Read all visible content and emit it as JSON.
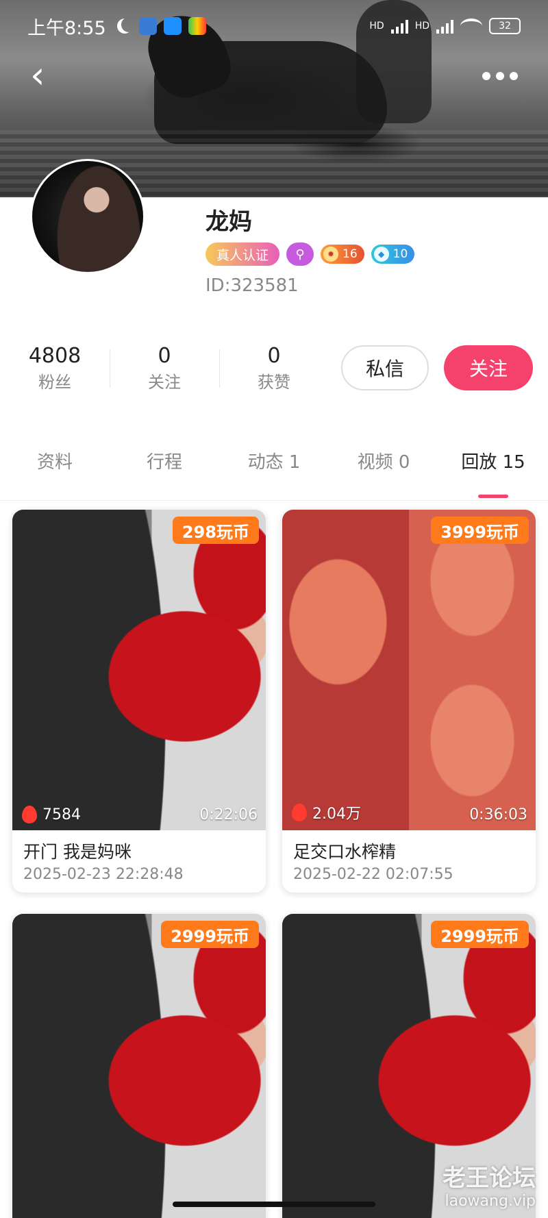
{
  "status_bar": {
    "time": "上午8:55",
    "battery": "32",
    "network": "HD"
  },
  "profile": {
    "nickname": "龙妈",
    "verify_badge": "真人认证",
    "level_fire": "16",
    "level_diamond": "10",
    "user_id": "ID:323581"
  },
  "stats": [
    {
      "value": "4808",
      "label": "粉丝"
    },
    {
      "value": "0",
      "label": "关注"
    },
    {
      "value": "0",
      "label": "获赞"
    }
  ],
  "actions": {
    "message": "私信",
    "follow": "关注"
  },
  "tabs": [
    {
      "label": "资料"
    },
    {
      "label": "行程"
    },
    {
      "label": "动态 1"
    },
    {
      "label": "视频 0"
    },
    {
      "label": "回放 15"
    }
  ],
  "active_tab": 4,
  "videos": [
    {
      "price": "298玩币",
      "views": "7584",
      "duration": "0:22:06",
      "title": "开门 我是妈咪",
      "date": "2025-02-23 22:28:48"
    },
    {
      "price": "3999玩币",
      "views": "2.04万",
      "duration": "0:36:03",
      "title": "足交口水榨精",
      "date": "2025-02-22 02:07:55"
    },
    {
      "price": "2999玩币"
    },
    {
      "price": "2999玩币"
    }
  ],
  "watermark": {
    "line1": "老王论坛",
    "line2": "laowang.vip"
  },
  "colors": {
    "accent": "#f5426c",
    "price_tag": "#ff7a1a"
  }
}
